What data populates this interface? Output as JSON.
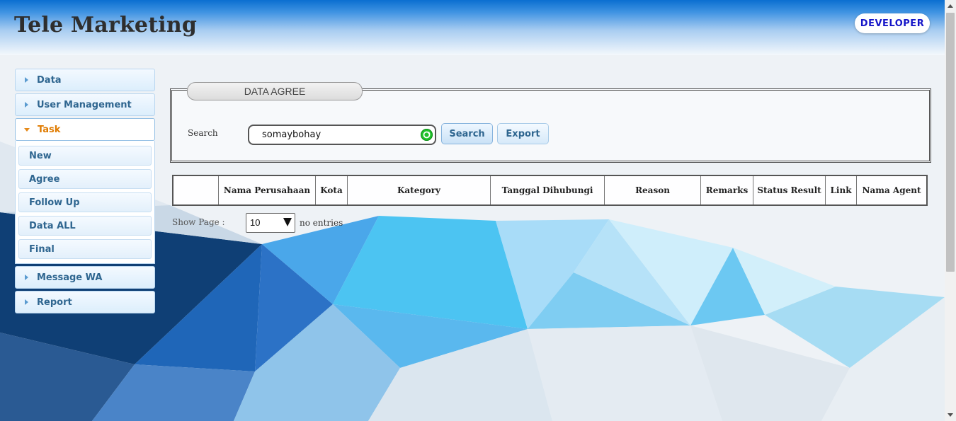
{
  "header": {
    "title": "Tele Marketing",
    "user_role": "DEVELOPER"
  },
  "sidebar": {
    "items": [
      {
        "label": "Data"
      },
      {
        "label": "User Management"
      },
      {
        "label": "Task",
        "open": true,
        "children": [
          {
            "label": "New"
          },
          {
            "label": "Agree"
          },
          {
            "label": "Follow Up"
          },
          {
            "label": "Data ALL"
          },
          {
            "label": "Final"
          }
        ]
      },
      {
        "label": "Message WA"
      },
      {
        "label": "Report"
      }
    ]
  },
  "panel": {
    "tab_title": "DATA AGREE",
    "search_label": "Search",
    "search_value": "somaybohay",
    "search_button": "Search",
    "export_button": "Export"
  },
  "table": {
    "columns": [
      "",
      "Nama Perusahaan",
      "Kota",
      "Kategory",
      "Tanggal Dihubungi",
      "Reason",
      "Remarks",
      "Status Result",
      "Link",
      "Nama Agent"
    ]
  },
  "paging": {
    "show_label": "Show Page :",
    "page_size": "10",
    "entries_label": "no entries"
  },
  "colors": {
    "header_blue": "#0b6fd0",
    "active_menu": "#e07b00",
    "menu_text": "#2f6690",
    "role_text": "#1515c8"
  }
}
